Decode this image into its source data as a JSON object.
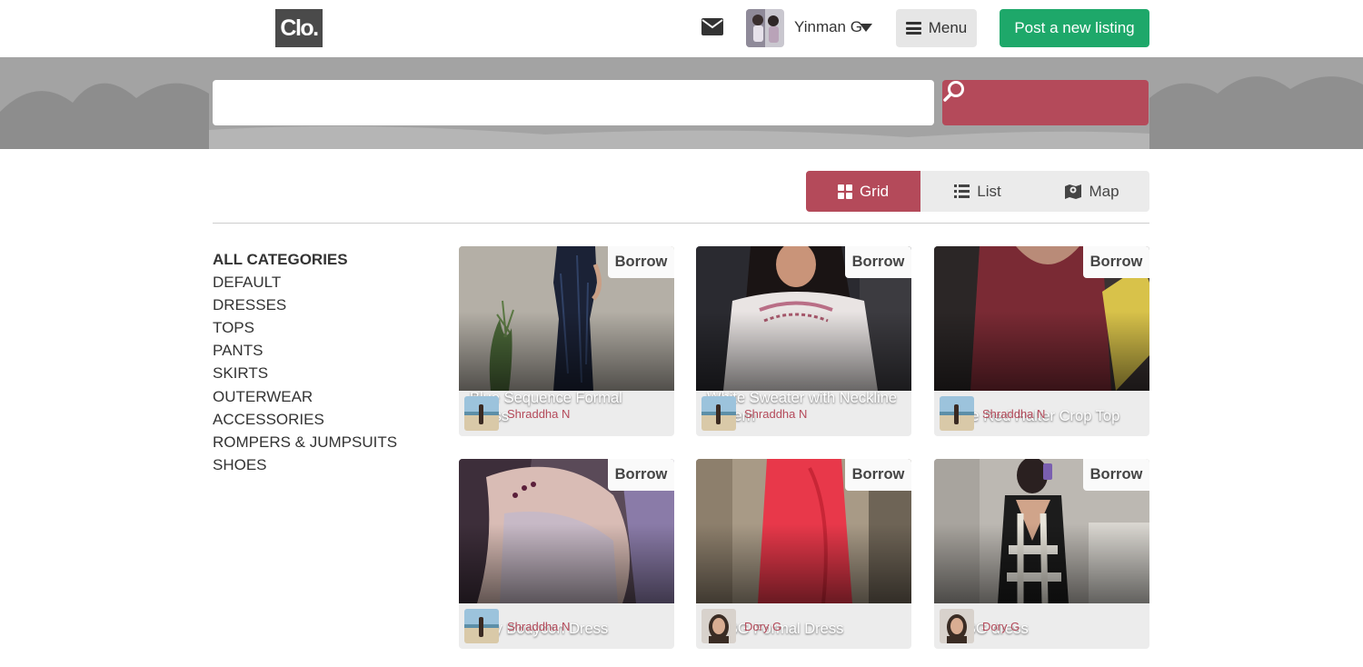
{
  "header": {
    "logo_text": "Clo.",
    "user_name": "Yinman G",
    "menu_label": "Menu",
    "post_label": "Post a new listing"
  },
  "search": {
    "value": "",
    "placeholder": ""
  },
  "view_toggle": {
    "options": [
      {
        "label": "Grid",
        "icon": "grid-icon",
        "active": true
      },
      {
        "label": "List",
        "icon": "list-icon",
        "active": false
      },
      {
        "label": "Map",
        "icon": "map-icon",
        "active": false
      }
    ]
  },
  "categories": [
    "ALL CATEGORIES",
    "DEFAULT",
    "DRESSES",
    "TOPS",
    "PANTS",
    "SKIRTS",
    "OUTERWEAR",
    "ACCESSORIES",
    "ROMPERS & JUMPSUITS",
    "SHOES"
  ],
  "listings": [
    {
      "title": "Blue Sequence Formal Dress",
      "action": "Borrow",
      "owner": "Shraddha N"
    },
    {
      "title": "White Sweater with Neckline Pattern",
      "action": "Borrow",
      "owner": "Shraddha N"
    },
    {
      "title": "Wine Red Halter Crop Top",
      "action": "Borrow",
      "owner": "Shraddha N"
    },
    {
      "title": "Grey Bodycon Dress",
      "action": "Borrow",
      "owner": "Shraddha N"
    },
    {
      "title": "BCBG Formal Dress",
      "action": "Borrow",
      "owner": "Dory G"
    },
    {
      "title": "BCBG dress",
      "action": "Borrow",
      "owner": "Dory G"
    }
  ],
  "colors": {
    "accent": "#b44a5a",
    "post_button": "#1ea86a",
    "logo_bg": "#4a4a4a"
  }
}
